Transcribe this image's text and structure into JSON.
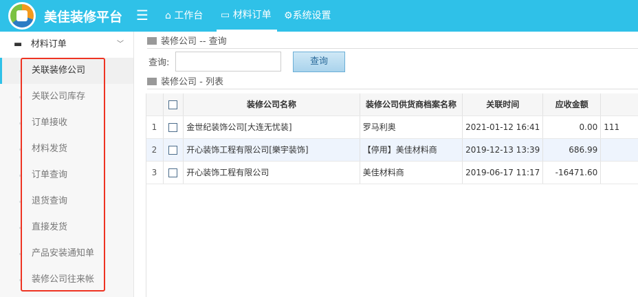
{
  "header": {
    "brand": "美佳装修平台",
    "nav": [
      {
        "label": "工作台",
        "icon": "home-icon"
      },
      {
        "label": "材料订单",
        "icon": "monitor-icon"
      },
      {
        "label": "系统设置",
        "icon": "gear-icon"
      }
    ]
  },
  "sidebar": {
    "group": "材料订单",
    "items": [
      {
        "label": "关联装修公司"
      },
      {
        "label": "关联公司库存"
      },
      {
        "label": "订单接收"
      },
      {
        "label": "材料发货"
      },
      {
        "label": "订单查询"
      },
      {
        "label": "退货查询"
      },
      {
        "label": "直接发货"
      },
      {
        "label": "产品安装通知单"
      },
      {
        "label": "装修公司往来帐"
      }
    ]
  },
  "query": {
    "title": "装修公司 -- 查询",
    "label": "查询:",
    "value": "",
    "button": "查询"
  },
  "list": {
    "title": "装修公司 - 列表",
    "columns": [
      "装修公司名称",
      "装修公司供货商档案名称",
      "关联时间",
      "应收金额"
    ],
    "rows": [
      {
        "n": "1",
        "name": "金世纪装饰公司[大连无忧装]",
        "supplier": "罗马利奥",
        "time": "2021-01-12 16:41",
        "amount": "0.00",
        "extra": "111"
      },
      {
        "n": "2",
        "name": "开心装饰工程有限公司[樂宇装饰]",
        "supplier": "【停用】美佳材料商",
        "time": "2019-12-13 13:39",
        "amount": "686.99",
        "extra": ""
      },
      {
        "n": "3",
        "name": "开心装饰工程有限公司",
        "supplier": "美佳材料商",
        "time": "2019-06-17 11:17",
        "amount": "-16471.60",
        "extra": ""
      }
    ]
  },
  "colors": {
    "header": "#2fc1e8",
    "highlight": "#e32"
  }
}
